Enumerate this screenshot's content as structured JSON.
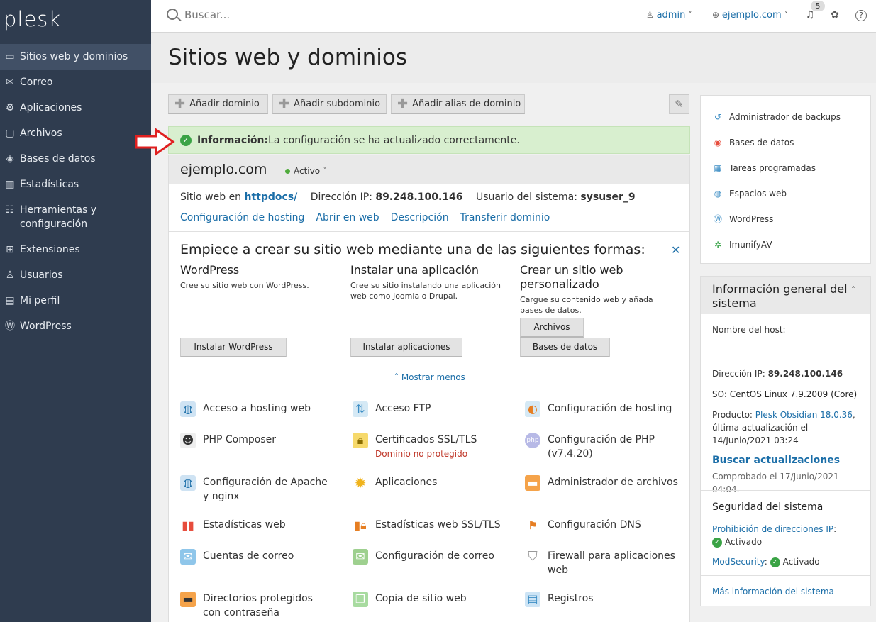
{
  "app": {
    "logo": "plesk"
  },
  "sidebar": {
    "items": [
      {
        "label": "Sitios web y dominios",
        "icon": "monitor-icon"
      },
      {
        "label": "Correo",
        "icon": "mail-icon"
      },
      {
        "label": "Aplicaciones",
        "icon": "gear-icon"
      },
      {
        "label": "Archivos",
        "icon": "folder-icon"
      },
      {
        "label": "Bases de datos",
        "icon": "database-icon"
      },
      {
        "label": "Estadísticas",
        "icon": "bar-chart-icon"
      },
      {
        "label": "Herramientas y configuración",
        "icon": "sliders-icon"
      },
      {
        "label": "Extensiones",
        "icon": "grid-icon"
      },
      {
        "label": "Usuarios",
        "icon": "user-icon"
      },
      {
        "label": "Mi perfil",
        "icon": "id-card-icon"
      },
      {
        "label": "WordPress",
        "icon": "wordpress-icon"
      }
    ]
  },
  "topbar": {
    "search_placeholder": "Buscar...",
    "user": "admin",
    "domain": "ejemplo.com",
    "notifications": "5"
  },
  "page": {
    "title": "Sitios web y dominios"
  },
  "toolbar": {
    "add_domain": "Añadir dominio",
    "add_subdomain": "Añadir subdominio",
    "add_alias": "Añadir alias de dominio"
  },
  "info": {
    "label": "Información:",
    "message": " La configuración se ha actualizado correctamente."
  },
  "domain": {
    "name": "ejemplo.com",
    "status": "Activo",
    "site_label": "Sitio web en ",
    "site_value": "httpdocs/",
    "ip_label": "Dirección IP: ",
    "ip_value": "89.248.100.146",
    "user_label": "Usuario del sistema: ",
    "user_value": "sysuser_9",
    "links": [
      "Configuración de hosting",
      "Abrir en web",
      "Descripción",
      "Transferir dominio"
    ]
  },
  "start": {
    "title": "Empiece a crear su sitio web mediante una de las siguientes formas:",
    "options": [
      {
        "title": "WordPress",
        "desc": "Cree su sitio web con WordPress.",
        "button": "Instalar WordPress"
      },
      {
        "title": "Instalar una aplicación",
        "desc": "Cree su sitio instalando una aplicación web como Joomla o Drupal.",
        "button": "Instalar aplicaciones"
      },
      {
        "title": "Crear un sitio web personalizado",
        "desc": "Cargue su contenido web y añada bases de datos.",
        "button": "Archivos",
        "button2": "Bases de datos"
      }
    ],
    "show_less": "Mostrar menos"
  },
  "tools": [
    {
      "label": "Acceso a hosting web",
      "icon": "globe-icon"
    },
    {
      "label": "Acceso FTP",
      "icon": "ftp-icon"
    },
    {
      "label": "Configuración de hosting",
      "icon": "hosting-icon"
    },
    {
      "label": "PHP Composer",
      "icon": "composer-icon"
    },
    {
      "label": "Certificados SSL/TLS",
      "icon": "lock-icon",
      "sub": "Dominio no protegido"
    },
    {
      "label": "Configuración de PHP (v7.4.20)",
      "icon": "php-icon"
    },
    {
      "label": "Configuración de Apache y nginx",
      "icon": "apache-icon"
    },
    {
      "label": "Aplicaciones",
      "icon": "gear-icon"
    },
    {
      "label": "Administrador de archivos",
      "icon": "folder-icon"
    },
    {
      "label": "Estadísticas web",
      "icon": "stats-icon"
    },
    {
      "label": "Estadísticas web SSL/TLS",
      "icon": "stats-lock-icon"
    },
    {
      "label": "Configuración DNS",
      "icon": "dns-icon"
    },
    {
      "label": "Cuentas de correo",
      "icon": "mail-icon"
    },
    {
      "label": "Configuración de correo",
      "icon": "mail-settings-icon"
    },
    {
      "label": "Firewall para aplicaciones web",
      "icon": "shield-icon"
    },
    {
      "label": "Directorios protegidos con contraseña",
      "icon": "protected-folder-icon"
    },
    {
      "label": "Copia de sitio web",
      "icon": "copy-icon"
    },
    {
      "label": "Registros",
      "icon": "logs-icon"
    }
  ],
  "right_links": [
    {
      "label": "Administrador de backups",
      "icon": "backup-icon"
    },
    {
      "label": "Bases de datos",
      "icon": "database-icon"
    },
    {
      "label": "Tareas programadas",
      "icon": "calendar-icon"
    },
    {
      "label": "Espacios web",
      "icon": "globe-icon"
    },
    {
      "label": "WordPress",
      "icon": "wordpress-icon"
    },
    {
      "label": "ImunifyAV",
      "icon": "imunify-icon"
    }
  ],
  "system": {
    "title": "Información general del sistema",
    "host_label": "Nombre del host:",
    "ip_label": "Dirección IP: ",
    "ip_value": "89.248.100.146",
    "os_label": "SO: ",
    "os_value": "CentOS Linux 7.9.2009 (Core)",
    "product_label": "Producto: ",
    "product_value": "Plesk Obsidian 18.0.36",
    "product_updated": "última actualización el 14/Junio/2021 03:24",
    "check_updates": "Buscar actualizaciones",
    "checked": "Comprobado el 17/Junio/2021 04:04.",
    "security_title": "Seguridad del sistema",
    "ip_ban": "Prohibición de direcciones IP",
    "ip_ban_status": "Activado",
    "modsecurity": "ModSecurity",
    "modsecurity_status": "Activado",
    "more_info": "Más información del sistema"
  },
  "colors": {
    "sidebar": "#2f3c4f",
    "link": "#1b6ea8",
    "success_bg": "#d8efcf",
    "alert_red": "#c0392b"
  }
}
